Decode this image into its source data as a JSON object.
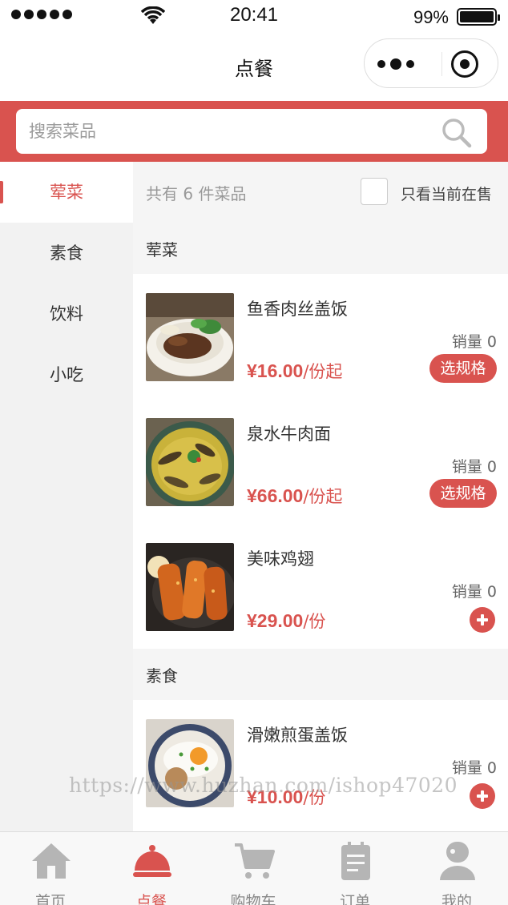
{
  "status_bar": {
    "time": "20:41",
    "battery": "99%"
  },
  "nav": {
    "title": "点餐",
    "more_icon": "more-dots-icon",
    "close_icon": "target-circle-icon"
  },
  "search": {
    "placeholder": "搜索菜品",
    "icon": "search-icon"
  },
  "categories": [
    {
      "label": "荤菜",
      "active": true
    },
    {
      "label": "素食",
      "active": false
    },
    {
      "label": "饮料",
      "active": false
    },
    {
      "label": "小吃",
      "active": false
    }
  ],
  "summary": {
    "count_text": "共有 6 件菜品",
    "filter_label": "只看当前在售",
    "filter_checked": false
  },
  "sections": [
    {
      "title": "荤菜",
      "dishes": [
        {
          "name": "鱼香肉丝盖饭",
          "sales": "销量 0",
          "price": "¥16.00",
          "unit": "/份起",
          "action": "选规格"
        },
        {
          "name": "泉水牛肉面",
          "sales": "销量 0",
          "price": "¥66.00",
          "unit": "/份起",
          "action": "选规格"
        },
        {
          "name": "美味鸡翅",
          "sales": "销量 0",
          "price": "¥29.00",
          "unit": "/份",
          "action": "add-icon"
        }
      ]
    },
    {
      "title": "素食",
      "dishes": [
        {
          "name": "滑嫩煎蛋盖饭",
          "sales": "销量 0",
          "price": "¥10.00",
          "unit": "/份",
          "action": "add-icon"
        }
      ]
    }
  ],
  "watermark": "https://www.huzhan.com/ishop47020",
  "tabs": [
    {
      "label": "首页",
      "icon": "home-icon",
      "active": false
    },
    {
      "label": "点餐",
      "icon": "cloche-icon",
      "active": true
    },
    {
      "label": "购物车",
      "icon": "cart-icon",
      "active": false
    },
    {
      "label": "订单",
      "icon": "order-list-icon",
      "active": false
    },
    {
      "label": "我的",
      "icon": "user-icon",
      "active": false
    }
  ],
  "colors": {
    "accent": "#d9534f",
    "sidebar_bg": "#f2f2f2",
    "inactive_icon": "#b5b5b5"
  }
}
